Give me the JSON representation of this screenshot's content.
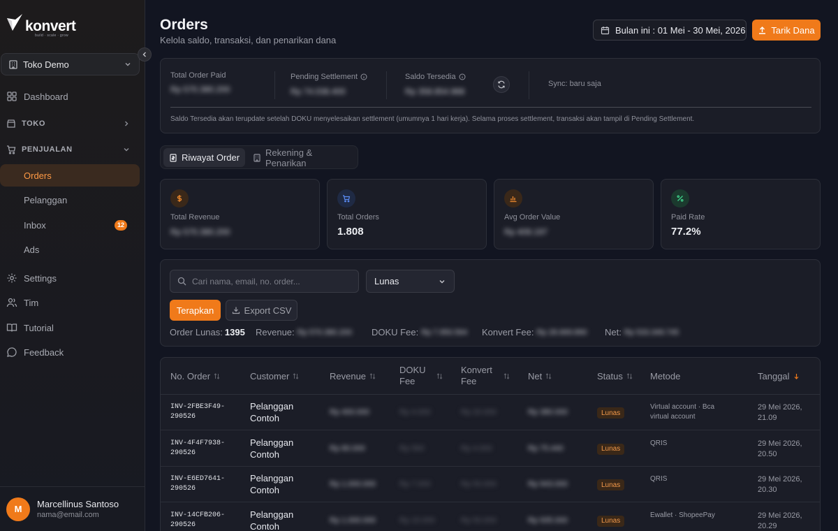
{
  "brand": {
    "name": "konvert",
    "tagline": "build · scale · grow",
    "accent": "#f07a1a"
  },
  "store": {
    "name": "Toko Demo"
  },
  "nav": {
    "dashboard": "Dashboard",
    "toko": "TOKO",
    "penjualan": "PENJUALAN",
    "orders": "Orders",
    "pelanggan": "Pelanggan",
    "inbox": "Inbox",
    "inbox_badge": "12",
    "ads": "Ads",
    "settings": "Settings",
    "tim": "Tim",
    "tutorial": "Tutorial",
    "feedback": "Feedback"
  },
  "user": {
    "initial": "M",
    "name": "Marcellinus Santoso",
    "email": "nama@email.com"
  },
  "header": {
    "title": "Orders",
    "subtitle": "Kelola saldo, transaksi, dan penarikan dana",
    "date_range": "Bulan ini : 01 Mei - 30 Mei, 2026",
    "withdraw": "Tarik Dana"
  },
  "balance": {
    "total_paid_label": "Total Order Paid",
    "total_paid_value": "Rp 570.380.200",
    "pending_label": "Pending Settlement",
    "pending_value": "Rp 74.038.400",
    "available_label": "Saldo Tersedia",
    "available_value": "Rp 358.854.988",
    "sync": "Sync: baru saja",
    "note": "Saldo Tersedia akan terupdate setelah DOKU menyelesaikan settlement (umumnya 1 hari kerja). Selama proses settlement, transaksi akan tampil di Pending Settlement."
  },
  "tabs": {
    "history": "Riwayat Order",
    "accounts": "Rekening & Penarikan"
  },
  "stats": {
    "revenue_label": "Total Revenue",
    "revenue_value": "Rp 570.380.200",
    "orders_label": "Total Orders",
    "orders_value": "1.808",
    "aov_label": "Avg Order Value",
    "aov_value": "Rp 409.197",
    "paid_label": "Paid Rate",
    "paid_value": "77.2%"
  },
  "filter": {
    "search_placeholder": "Cari nama, email, no. order...",
    "status": "Lunas",
    "apply": "Terapkan",
    "export": "Export CSV",
    "orders_label": "Order Lunas:",
    "orders_count": "1395",
    "revenue_label": "Revenue:",
    "revenue_value": "Rp 570.380.200",
    "doku_label": "DOKU Fee:",
    "doku_value": "Rp 7.950.564",
    "konvert_label": "Konvert Fee:",
    "konvert_value": "Rp 28.669.890",
    "net_label": "Net:",
    "net_value": "Rp 533.349.745"
  },
  "table": {
    "headers": {
      "order": "No. Order",
      "customer": "Customer",
      "revenue": "Revenue",
      "doku_1": "DOKU",
      "doku_2": "Fee",
      "konvert_1": "Konvert",
      "konvert_2": "Fee",
      "net": "Net",
      "status": "Status",
      "method": "Metode",
      "date": "Tanggal"
    },
    "rows": [
      {
        "order_1": "INV-2FBE3F49-",
        "order_2": "290526",
        "customer_1": "Pelanggan",
        "customer_2": "Contoh",
        "revenue": "Rp 400.000",
        "doku": "Rp 4.000",
        "konvert": "Rp 20.000",
        "net": "Rp 380.000",
        "status": "Lunas",
        "method_1": "Virtual account · Bca",
        "method_2": "virtual account",
        "date_1": "29 Mei 2026,",
        "date_2": "21.09"
      },
      {
        "order_1": "INV-4F4F7938-",
        "order_2": "290526",
        "customer_1": "Pelanggan",
        "customer_2": "Contoh",
        "revenue": "Rp 80.000",
        "doku": "Rp 560",
        "konvert": "Rp 4.000",
        "net": "Rp 75.440",
        "status": "Lunas",
        "method_1": "QRIS",
        "method_2": "",
        "date_1": "29 Mei 2026,",
        "date_2": "20.50"
      },
      {
        "order_1": "INV-E6ED7641-",
        "order_2": "290526",
        "customer_1": "Pelanggan",
        "customer_2": "Contoh",
        "revenue": "Rp 1.000.000",
        "doku": "Rp 7.000",
        "konvert": "Rp 50.000",
        "net": "Rp 943.000",
        "status": "Lunas",
        "method_1": "QRIS",
        "method_2": "",
        "date_1": "29 Mei 2026,",
        "date_2": "20.30"
      },
      {
        "order_1": "INV-14CFB206-",
        "order_2": "290526",
        "customer_1": "Pelanggan",
        "customer_2": "Contoh",
        "revenue": "Rp 1.000.000",
        "doku": "Rp 15.000",
        "konvert": "Rp 50.000",
        "net": "Rp 935.000",
        "status": "Lunas",
        "method_1": "Ewallet · ShopeePay",
        "method_2": "",
        "date_1": "29 Mei 2026,",
        "date_2": "20.29"
      }
    ]
  }
}
